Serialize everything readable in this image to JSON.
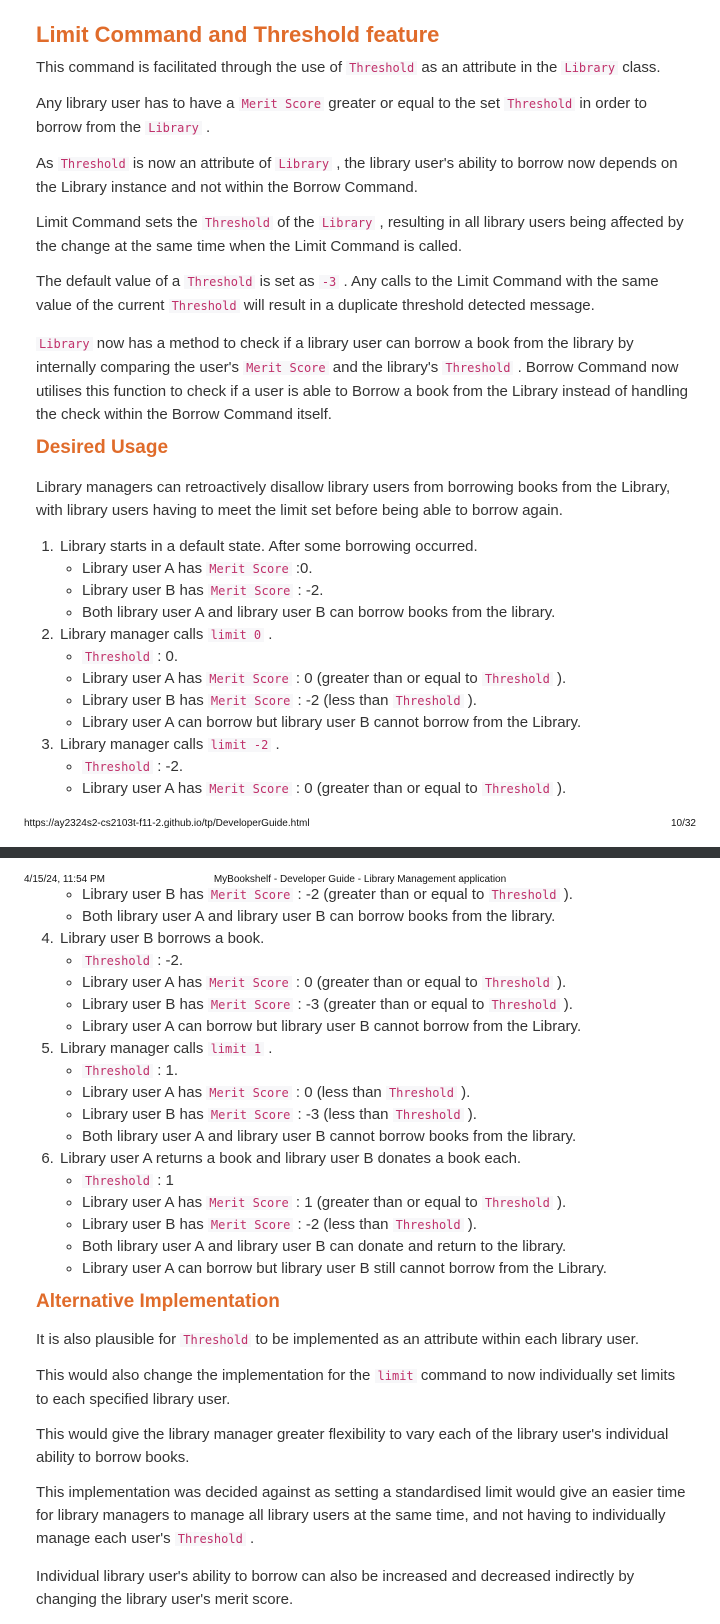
{
  "page1": {
    "heading_limit": "Limit Command and Threshold feature",
    "p1": [
      "This command is facilitated through the use of ",
      "Threshold",
      " as an attribute in the ",
      "Library",
      " class."
    ],
    "p2": [
      "Any library user has to have a ",
      "Merit Score",
      " greater or equal to the set ",
      "Threshold",
      " in order to borrow from the ",
      "Library",
      " ."
    ],
    "p3": [
      "As ",
      "Threshold",
      " is now an attribute of ",
      "Library",
      " , the library user's ability to borrow now depends on the Library instance and not within the Borrow Command."
    ],
    "p4": [
      "Limit Command sets the ",
      "Threshold",
      " of the ",
      "Library",
      " , resulting in all library users being affected by the change at the same time when the Limit Command is called."
    ],
    "p5": [
      "The default value of a ",
      "Threshold",
      " is set as ",
      "-3",
      " . Any calls to the Limit Command with the same value of the current ",
      "Threshold",
      " will result in a duplicate threshold detected message."
    ],
    "p6": [
      "Library",
      " now has a method to check if a library user can borrow a book from the library by internally comparing the user's ",
      "Merit Score",
      " and the library's ",
      "Threshold",
      " . Borrow Command now utilises this function to check if a user is able to Borrow a book from the Library instead of handling the check within the Borrow Command itself."
    ],
    "heading_desired": "Desired Usage",
    "p7": "Library managers can retroactively disallow library users from borrowing books from the Library, with library users having to meet the limit set before being able to borrow again.",
    "step1": "Library starts in a default state. After some borrowing occurred.",
    "step1_a": [
      "Library user A has ",
      "Merit Score",
      " :0."
    ],
    "step1_b": [
      "Library user B has ",
      "Merit Score",
      " : -2."
    ],
    "step1_c": "Both library user A and library user B can borrow books from the library.",
    "step2": [
      "Library manager calls ",
      "limit 0",
      " ."
    ],
    "step2_a": [
      "Threshold",
      " : 0."
    ],
    "step2_b": [
      "Library user A has ",
      "Merit Score",
      " : 0 (greater than or equal to ",
      "Threshold",
      " )."
    ],
    "step2_c": [
      "Library user B has ",
      "Merit Score",
      " : -2 (less than ",
      "Threshold",
      " )."
    ],
    "step2_d": "Library user A can borrow but library user B cannot borrow from the Library.",
    "step3": [
      "Library manager calls ",
      "limit -2",
      " ."
    ],
    "step3_a": [
      "Threshold",
      " : -2."
    ],
    "step3_b": [
      "Library user A has ",
      "Merit Score",
      " : 0 (greater than or equal to ",
      "Threshold",
      " )."
    ],
    "footer_url": "https://ay2324s2-cs2103t-f11-2.github.io/tp/DeveloperGuide.html",
    "footer_page": "10/32"
  },
  "page2": {
    "header_date": "4/15/24, 11:54 PM",
    "header_title": "MyBookshelf - Developer Guide - Library Management application",
    "step3_c": [
      "Library user B has ",
      "Merit Score",
      " : -2 (greater than or equal to ",
      "Threshold",
      " )."
    ],
    "step3_d": "Both library user A and library user B can borrow books from the library.",
    "step4": "Library user B borrows a book.",
    "step4_a": [
      "Threshold",
      " : -2."
    ],
    "step4_b": [
      "Library user A has ",
      "Merit Score",
      " : 0 (greater than or equal to ",
      "Threshold",
      " )."
    ],
    "step4_c": [
      "Library user B has ",
      "Merit Score",
      " : -3 (greater than or equal to ",
      "Threshold",
      " )."
    ],
    "step4_d": "Library user A can borrow but library user B cannot borrow from the Library.",
    "step5": [
      "Library manager calls ",
      "limit 1",
      " ."
    ],
    "step5_a": [
      "Threshold",
      " : 1."
    ],
    "step5_b": [
      "Library user A has ",
      "Merit Score",
      " : 0 (less than ",
      "Threshold",
      " )."
    ],
    "step5_c": [
      "Library user B has ",
      "Merit Score",
      " : -3 (less than ",
      "Threshold",
      " )."
    ],
    "step5_d": "Both library user A and library user B cannot borrow books from the library.",
    "step6": "Library user A returns a book and library user B donates a book each.",
    "step6_a": [
      "Threshold",
      " : 1"
    ],
    "step6_b": [
      "Library user A has ",
      "Merit Score",
      " : 1 (greater than or equal to ",
      "Threshold",
      " )."
    ],
    "step6_c": [
      "Library user B has ",
      "Merit Score",
      " : -2 (less than ",
      "Threshold",
      " )."
    ],
    "step6_d": "Both library user A and library user B can donate and return to the library.",
    "step6_e": "Library user A can borrow but library user B still cannot borrow from the Library.",
    "heading_alt": "Alternative Implementation",
    "a1": [
      "It is also plausible for ",
      "Threshold",
      " to be implemented as an attribute within each library user."
    ],
    "a2": [
      "This would also change the implementation for the ",
      "limit",
      " command to now individually set limits to each specified library user."
    ],
    "a3": "This would give the library manager greater flexibility to vary each of the library user's individual ability to borrow books.",
    "a4": [
      "This implementation was decided against as setting a standardised limit would give an easier time for library managers to manage all library users at the same time, and not having to individually manage each user's ",
      "Threshold",
      " ."
    ],
    "a5": "Individual library user's ability to borrow can also be increased and decreased indirectly by changing the library user's merit score."
  }
}
